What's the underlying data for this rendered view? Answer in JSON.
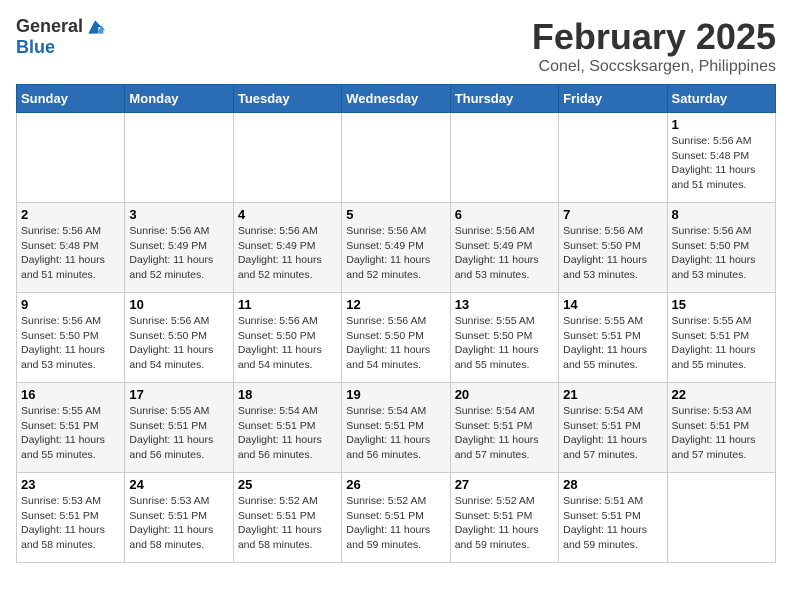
{
  "logo": {
    "general": "General",
    "blue": "Blue"
  },
  "title": "February 2025",
  "subtitle": "Conel, Soccsksargen, Philippines",
  "days_of_week": [
    "Sunday",
    "Monday",
    "Tuesday",
    "Wednesday",
    "Thursday",
    "Friday",
    "Saturday"
  ],
  "weeks": [
    {
      "cells": [
        {
          "empty": true
        },
        {
          "empty": true
        },
        {
          "empty": true
        },
        {
          "empty": true
        },
        {
          "empty": true
        },
        {
          "empty": true
        },
        {
          "day": "1",
          "sunrise": "Sunrise: 5:56 AM",
          "sunset": "Sunset: 5:48 PM",
          "daylight": "Daylight: 11 hours and 51 minutes."
        }
      ]
    },
    {
      "cells": [
        {
          "day": "2",
          "sunrise": "Sunrise: 5:56 AM",
          "sunset": "Sunset: 5:48 PM",
          "daylight": "Daylight: 11 hours and 51 minutes."
        },
        {
          "day": "3",
          "sunrise": "Sunrise: 5:56 AM",
          "sunset": "Sunset: 5:49 PM",
          "daylight": "Daylight: 11 hours and 52 minutes."
        },
        {
          "day": "4",
          "sunrise": "Sunrise: 5:56 AM",
          "sunset": "Sunset: 5:49 PM",
          "daylight": "Daylight: 11 hours and 52 minutes."
        },
        {
          "day": "5",
          "sunrise": "Sunrise: 5:56 AM",
          "sunset": "Sunset: 5:49 PM",
          "daylight": "Daylight: 11 hours and 52 minutes."
        },
        {
          "day": "6",
          "sunrise": "Sunrise: 5:56 AM",
          "sunset": "Sunset: 5:49 PM",
          "daylight": "Daylight: 11 hours and 53 minutes."
        },
        {
          "day": "7",
          "sunrise": "Sunrise: 5:56 AM",
          "sunset": "Sunset: 5:50 PM",
          "daylight": "Daylight: 11 hours and 53 minutes."
        },
        {
          "day": "8",
          "sunrise": "Sunrise: 5:56 AM",
          "sunset": "Sunset: 5:50 PM",
          "daylight": "Daylight: 11 hours and 53 minutes."
        }
      ]
    },
    {
      "cells": [
        {
          "day": "9",
          "sunrise": "Sunrise: 5:56 AM",
          "sunset": "Sunset: 5:50 PM",
          "daylight": "Daylight: 11 hours and 53 minutes."
        },
        {
          "day": "10",
          "sunrise": "Sunrise: 5:56 AM",
          "sunset": "Sunset: 5:50 PM",
          "daylight": "Daylight: 11 hours and 54 minutes."
        },
        {
          "day": "11",
          "sunrise": "Sunrise: 5:56 AM",
          "sunset": "Sunset: 5:50 PM",
          "daylight": "Daylight: 11 hours and 54 minutes."
        },
        {
          "day": "12",
          "sunrise": "Sunrise: 5:56 AM",
          "sunset": "Sunset: 5:50 PM",
          "daylight": "Daylight: 11 hours and 54 minutes."
        },
        {
          "day": "13",
          "sunrise": "Sunrise: 5:55 AM",
          "sunset": "Sunset: 5:50 PM",
          "daylight": "Daylight: 11 hours and 55 minutes."
        },
        {
          "day": "14",
          "sunrise": "Sunrise: 5:55 AM",
          "sunset": "Sunset: 5:51 PM",
          "daylight": "Daylight: 11 hours and 55 minutes."
        },
        {
          "day": "15",
          "sunrise": "Sunrise: 5:55 AM",
          "sunset": "Sunset: 5:51 PM",
          "daylight": "Daylight: 11 hours and 55 minutes."
        }
      ]
    },
    {
      "cells": [
        {
          "day": "16",
          "sunrise": "Sunrise: 5:55 AM",
          "sunset": "Sunset: 5:51 PM",
          "daylight": "Daylight: 11 hours and 55 minutes."
        },
        {
          "day": "17",
          "sunrise": "Sunrise: 5:55 AM",
          "sunset": "Sunset: 5:51 PM",
          "daylight": "Daylight: 11 hours and 56 minutes."
        },
        {
          "day": "18",
          "sunrise": "Sunrise: 5:54 AM",
          "sunset": "Sunset: 5:51 PM",
          "daylight": "Daylight: 11 hours and 56 minutes."
        },
        {
          "day": "19",
          "sunrise": "Sunrise: 5:54 AM",
          "sunset": "Sunset: 5:51 PM",
          "daylight": "Daylight: 11 hours and 56 minutes."
        },
        {
          "day": "20",
          "sunrise": "Sunrise: 5:54 AM",
          "sunset": "Sunset: 5:51 PM",
          "daylight": "Daylight: 11 hours and 57 minutes."
        },
        {
          "day": "21",
          "sunrise": "Sunrise: 5:54 AM",
          "sunset": "Sunset: 5:51 PM",
          "daylight": "Daylight: 11 hours and 57 minutes."
        },
        {
          "day": "22",
          "sunrise": "Sunrise: 5:53 AM",
          "sunset": "Sunset: 5:51 PM",
          "daylight": "Daylight: 11 hours and 57 minutes."
        }
      ]
    },
    {
      "cells": [
        {
          "day": "23",
          "sunrise": "Sunrise: 5:53 AM",
          "sunset": "Sunset: 5:51 PM",
          "daylight": "Daylight: 11 hours and 58 minutes."
        },
        {
          "day": "24",
          "sunrise": "Sunrise: 5:53 AM",
          "sunset": "Sunset: 5:51 PM",
          "daylight": "Daylight: 11 hours and 58 minutes."
        },
        {
          "day": "25",
          "sunrise": "Sunrise: 5:52 AM",
          "sunset": "Sunset: 5:51 PM",
          "daylight": "Daylight: 11 hours and 58 minutes."
        },
        {
          "day": "26",
          "sunrise": "Sunrise: 5:52 AM",
          "sunset": "Sunset: 5:51 PM",
          "daylight": "Daylight: 11 hours and 59 minutes."
        },
        {
          "day": "27",
          "sunrise": "Sunrise: 5:52 AM",
          "sunset": "Sunset: 5:51 PM",
          "daylight": "Daylight: 11 hours and 59 minutes."
        },
        {
          "day": "28",
          "sunrise": "Sunrise: 5:51 AM",
          "sunset": "Sunset: 5:51 PM",
          "daylight": "Daylight: 11 hours and 59 minutes."
        },
        {
          "empty": true
        }
      ]
    }
  ]
}
